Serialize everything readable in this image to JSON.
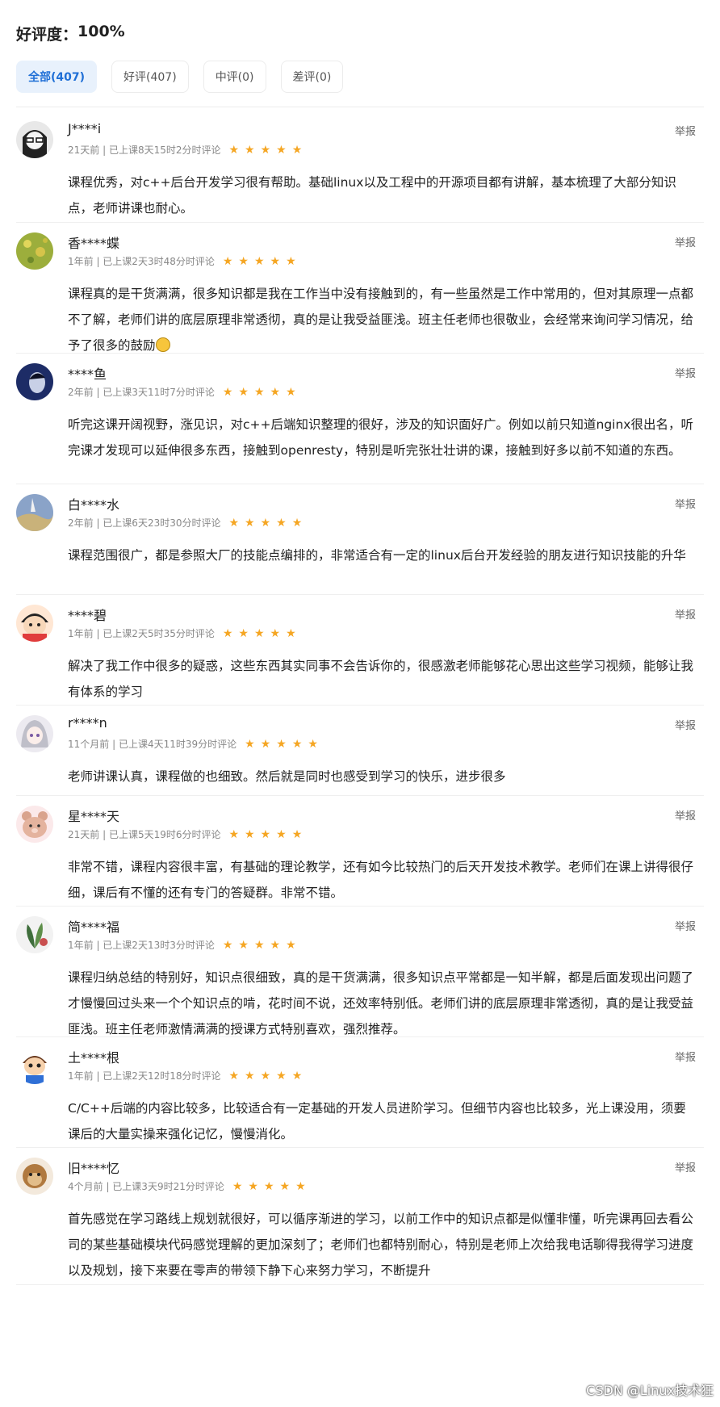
{
  "rating": {
    "label": "好评度：",
    "value": "100%"
  },
  "tabs": [
    {
      "label": "全部(407)",
      "active": true
    },
    {
      "label": "好评(407)",
      "active": false
    },
    {
      "label": "中评(0)",
      "active": false
    },
    {
      "label": "差评(0)",
      "active": false
    }
  ],
  "star_glyph": "★",
  "report_label": "举报",
  "reviews": [
    {
      "user": "J****i",
      "meta": "21天前 | 已上课8天15时2分时评论",
      "stars": 5,
      "avatar": "anime-avatar-glasses",
      "content": "课程优秀，对c++后台开发学习很有帮助。基础linux以及工程中的开源项目都有讲解，基本梳理了大部分知识点，老师讲课也耐心。"
    },
    {
      "user": "香****蝶",
      "meta": "1年前 | 已上课2天3时48分时评论",
      "stars": 5,
      "avatar": "flower-avatar",
      "content": "课程真的是干货满满，很多知识都是我在工作当中没有接触到的，有一些虽然是工作中常用的，但对其原理一点都不了解，老师们讲的底层原理非常透彻，真的是让我受益匪浅。班主任老师也很敬业，会经常来询问学习情况，给予了很多的鼓励"
    },
    {
      "user": "****鱼",
      "meta": "2年前 | 已上课3天11时7分时评论",
      "stars": 5,
      "avatar": "portrait-avatar",
      "content": "听完这课开阔视野，涨见识，对c++后端知识整理的很好，涉及的知识面好广。例如以前只知道nginx很出名，听完课才发现可以延伸很多东西，接触到openresty，特别是听完张壮壮讲的课，接触到好多以前不知道的东西。"
    },
    {
      "user": "白****水",
      "meta": "2年前 | 已上课6天23时30分时评论",
      "stars": 5,
      "avatar": "sky-avatar",
      "content": "课程范围很广，都是参照大厂的技能点编排的，非常适合有一定的linux后台开发经验的朋友进行知识技能的升华"
    },
    {
      "user": "****碧",
      "meta": "1年前 | 已上课2天5时35分时评论",
      "stars": 5,
      "avatar": "cartoon-boy-avatar",
      "content": "解决了我工作中很多的疑惑，这些东西其实同事不会告诉你的，很感激老师能够花心思出这些学习视频，能够让我有体系的学习"
    },
    {
      "user": "r****n",
      "meta": "11个月前 | 已上课4天11时39分时评论",
      "stars": 5,
      "avatar": "anime-avatar-silver",
      "content": "老师讲课认真，课程做的也细致。然后就是同时也感受到学习的快乐，进步很多"
    },
    {
      "user": "星****天",
      "meta": "21天前 | 已上课5天19时6分时评论",
      "stars": 5,
      "avatar": "bear-avatar",
      "content": "非常不错，课程内容很丰富，有基础的理论教学，还有如今比较热门的后天开发技术教学。老师们在课上讲得很仔细，课后有不懂的还有专门的答疑群。非常不错。"
    },
    {
      "user": "简****福",
      "meta": "1年前 | 已上课2天13时3分时评论",
      "stars": 5,
      "avatar": "plant-avatar",
      "content": "课程归纳总结的特别好，知识点很细致，真的是干货满满，很多知识点平常都是一知半解，都是后面发现出问题了才慢慢回过头来一个个知识点的啃，花时间不说，还效率特别低。老师们讲的底层原理非常透彻，真的是让我受益匪浅。班主任老师激情满满的授课方式特别喜欢，强烈推荐。"
    },
    {
      "user": "土****根",
      "meta": "1年前 | 已上课2天12时18分时评论",
      "stars": 5,
      "avatar": "cartoon-kid-avatar",
      "content": "C/C++后端的内容比较多，比较适合有一定基础的开发人员进阶学习。但细节内容也比较多，光上课没用，须要课后的大量实操来强化记忆，慢慢消化。"
    },
    {
      "user": "旧****忆",
      "meta": "4个月前 | 已上课3天9时21分时评论",
      "stars": 5,
      "avatar": "monkey-avatar",
      "content": "首先感觉在学习路线上规划就很好，可以循序渐进的学习，以前工作中的知识点都是似懂非懂，听完课再回去看公司的某些基础模块代码感觉理解的更加深刻了；老师们也都特别耐心，特别是老师上次给我电话聊得我得学习进度以及规划，接下来要在零声的带领下静下心来努力学习，不断提升"
    }
  ],
  "watermark": "CSDN @Linux技术狂"
}
